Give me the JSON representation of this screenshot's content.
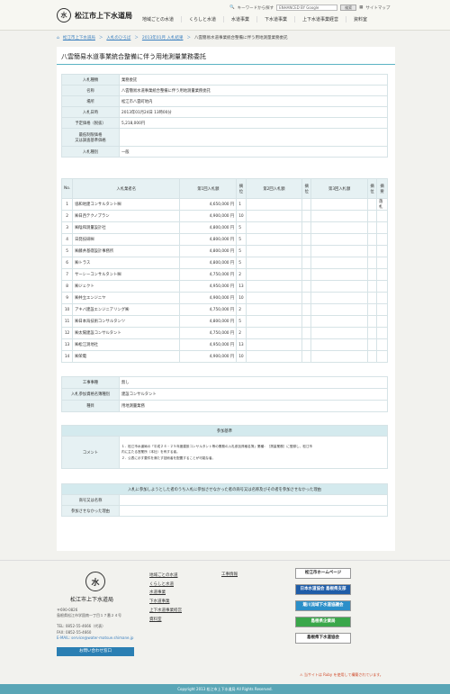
{
  "header": {
    "logo_text": "松江市上下水道局",
    "logo_glyph": "水",
    "search_label": "キーワードから探す",
    "search_placeholder": "ENHANCED BY Google",
    "search_button": "検索",
    "sitemap": "サイトマップ",
    "nav": [
      "地域ごとの水道",
      "くらしと水道",
      "水道事業",
      "下水道事業",
      "上下水道事業経営",
      "資料室"
    ]
  },
  "breadcrumb": [
    "松江市上下水道局",
    "入札のひろば",
    "2013年01月 入札結果",
    "八雲簡易水道事業統合整備に伴う用地測量業務委託"
  ],
  "page_title": "八雲簡易水道事業統合整備に伴う用地測量業務委託",
  "info": [
    {
      "label": "入札種類",
      "value": "業務委託"
    },
    {
      "label": "名称",
      "value": "八雲簡易水道事業統合整備に伴う用地測量業務委託"
    },
    {
      "label": "場所",
      "value": "松江市八雲町地内"
    },
    {
      "label": "入札日時",
      "value": "2013年01月24日 13時00分"
    },
    {
      "label": "予定価格（税抜）",
      "value": "5,218,000円"
    },
    {
      "label": "最低制限価格\n又は調査基準価格",
      "value": ""
    },
    {
      "label": "入札種別",
      "value": "一般"
    }
  ],
  "bid_headers": [
    "No.",
    "入札業者名",
    "第1回入札額",
    "摘位",
    "第2回入札額",
    "摘位",
    "第3回入札額",
    "摘位",
    "摘要"
  ],
  "bids": [
    {
      "no": "1",
      "name": "協和地建コンサルタント㈱",
      "amount": "4,650,000 円",
      "rank": "1",
      "note": "落札"
    },
    {
      "no": "2",
      "name": "㈱日西テクノプラン",
      "amount": "4,900,000 円",
      "rank": "10",
      "note": ""
    },
    {
      "no": "3",
      "name": "㈱陰和測量設計社",
      "amount": "4,800,000 円",
      "rank": "5",
      "note": ""
    },
    {
      "no": "4",
      "name": "日発技研㈱",
      "amount": "4,800,000 円",
      "rank": "5",
      "note": ""
    },
    {
      "no": "5",
      "name": "㈱藤井基礎設計事務所",
      "amount": "4,800,000 円",
      "rank": "5",
      "note": ""
    },
    {
      "no": "6",
      "name": "㈱トラス",
      "amount": "4,800,000 円",
      "rank": "5",
      "note": ""
    },
    {
      "no": "7",
      "name": "サーシーコンサルタント㈱",
      "amount": "4,750,000 円",
      "rank": "2",
      "note": ""
    },
    {
      "no": "8",
      "name": "㈱ジェクト",
      "amount": "4,950,000 円",
      "rank": "13",
      "note": ""
    },
    {
      "no": "9",
      "name": "㈱共立エンジニヤ",
      "amount": "4,900,000 円",
      "rank": "10",
      "note": ""
    },
    {
      "no": "10",
      "name": "アキバ建設エンジニアリング㈱",
      "amount": "4,750,000 円",
      "rank": "2",
      "note": ""
    },
    {
      "no": "11",
      "name": "㈱日本海技術コンサルタンツ",
      "amount": "4,800,000 円",
      "rank": "5",
      "note": ""
    },
    {
      "no": "12",
      "name": "㈱太陽建設コンサルタント",
      "amount": "4,750,000 円",
      "rank": "2",
      "note": ""
    },
    {
      "no": "13",
      "name": "㈱松江測地社",
      "amount": "4,950,000 円",
      "rank": "13",
      "note": ""
    },
    {
      "no": "14",
      "name": "㈱荣電",
      "amount": "4,900,000 円",
      "rank": "10",
      "note": ""
    }
  ],
  "extra": [
    {
      "label": "工事事種",
      "value": "無し"
    },
    {
      "label": "入札参加資格名簿種別",
      "value": "建設コンサルタント"
    },
    {
      "label": "種目",
      "value": "用地測量業務"
    }
  ],
  "criteria_head": "参加基準",
  "criteria_label": "コメント",
  "criteria_lines": [
    "１．松江市水道局の「平成２４・２５年度建設コンサルタント等の業務の入札参加資格名簿」業種：［測量業務］に登録し、松江市",
    "内に主たる営業所（本社）を有する者。",
    "２．公表に示す要件を満たす技術者を配置することが可能な者。"
  ],
  "nonpart_head": "入札に参加しようとした者のうち入札に参加させなかった者の商号又は名称及びその者を参加させなかった理由",
  "nonpart_rows": [
    "商号又は名称",
    "参加させなかった理由"
  ],
  "footer": {
    "name": "松江市上下水道局",
    "logo_glyph": "水",
    "address": [
      "〒690-0826",
      "島根県松江市学園南一丁目１７番２４号",
      "",
      "TEL: 0852-55-4666（代表）",
      "FAX: 0852-55-4660",
      "E-MAIL: service@water-matsue.shimane.jp"
    ],
    "contact_button": "お問い合わせ窓口",
    "links": [
      "地域ごとの水道",
      "くらしと水道",
      "水道事業",
      "下水道事業",
      "上下水道事業経営",
      "資料室"
    ],
    "links2": "工事情報",
    "banners": [
      {
        "label": "松江市ホームページ",
        "color": "#ffffff",
        "text": "#222222"
      },
      {
        "label": "日本水道協会 島根県支部",
        "color": "#1f5da8",
        "text": "#ffffff"
      },
      {
        "label": "簸川流域下水道協議会",
        "color": "#2b8fc9",
        "text": "#ffffff"
      },
      {
        "label": "島根県企業局",
        "color": "#3aa74a",
        "text": "#ffffff"
      },
      {
        "label": "島根県下水道協会",
        "color": "#ffffff",
        "text": "#222222"
      }
    ],
    "note": "当サイトは Ruby を使用して構築されています。",
    "copyright": "Copyright 2013 松江市上下水道局 All Rights Reserved."
  }
}
